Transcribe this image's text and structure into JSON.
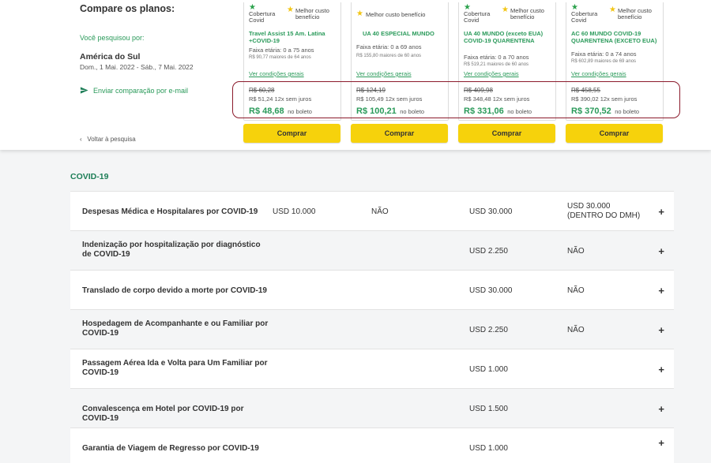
{
  "sidebar": {
    "title": "Compare os planos:",
    "searched_label": "Você pesquisou por:",
    "destination": "América do Sul",
    "dates": "Dom., 1 Mai. 2022 - Sáb., 7 Mai. 2022",
    "email_link": "Enviar comparação por e-mail",
    "back_link": "Voltar à pesquisa"
  },
  "plans": [
    {
      "badge_covid": "Cobertura Covid",
      "badge_best": "Melhor custo benefício",
      "name": "Travel Assist 15 Am. Latina +COVID-19",
      "age": "Faixa etária: 0 a 75 anos",
      "older": "R$ 90,77 maiores de 64 anos",
      "conditions": "Ver condições gerais",
      "old_price": "R$ 60,28",
      "installments": "R$ 51,24 12x sem juros",
      "price": "R$ 48,68",
      "boleto": "no boleto",
      "buy": "Comprar"
    },
    {
      "badge_covid": "",
      "badge_best": "Melhor custo benefício",
      "name": "UA 40 ESPECIAL MUNDO",
      "age": "Faixa etária: 0 a 69 anos",
      "older": "R$ 155,80 maiores de 60 anos",
      "conditions": "Ver condições gerais",
      "old_price": "R$ 124,19",
      "installments": "R$ 105,49 12x sem juros",
      "price": "R$ 100,21",
      "boleto": "no boleto",
      "buy": "Comprar"
    },
    {
      "badge_covid": "Cobertura Covid",
      "badge_best": "Melhor custo benefício",
      "name": "UA 40 MUNDO (exceto EUA) COVID-19 QUARENTENA",
      "age": "Faixa etária: 0 a 70 anos",
      "older": "R$ 519,21 maiores de 60 anos",
      "conditions": "Ver condições gerais",
      "old_price": "R$ 409,98",
      "installments": "R$ 348,48 12x sem juros",
      "price": "R$ 331,06",
      "boleto": "no boleto",
      "buy": "Comprar"
    },
    {
      "badge_covid": "Cobertura Covid",
      "badge_best": "Melhor custo benefício",
      "name": "AC 60 MUNDO COVID-19 QUARENTENA (EXCETO EUA)",
      "age": "Faixa etária: 0 a 74 anos",
      "older": "R$ 602,89 maiores de 69 anos",
      "conditions": "Ver condições gerais",
      "old_price": "R$ 458,55",
      "installments": "R$ 390,02 12x sem juros",
      "price": "R$ 370,52",
      "boleto": "no boleto",
      "buy": "Comprar"
    }
  ],
  "section": {
    "title": "COVID-19",
    "rows": [
      {
        "label": "Despesas Médica e Hospitalares por COVID-19",
        "values": [
          "USD 10.000",
          "NÃO",
          "USD 30.000",
          "USD 30.000 (DENTRO DO DMH)"
        ]
      },
      {
        "label": "Indenização por hospitalização por diagnóstico de COVID-19",
        "values": [
          "",
          "",
          "USD 2.250",
          "NÃO"
        ]
      },
      {
        "label": "Translado de corpo devido a morte por COVID-19",
        "values": [
          "",
          "",
          "USD 30.000",
          "NÃO"
        ]
      },
      {
        "label": "Hospedagem de Acompanhante e ou Familiar por COVID-19",
        "values": [
          "",
          "",
          "USD 2.250",
          "NÃO"
        ]
      },
      {
        "label": "Passagem Aérea Ida e Volta para Um Familiar por COVID-19",
        "values": [
          "",
          "",
          "USD 1.000",
          ""
        ]
      },
      {
        "label": "Convalescença em Hotel por COVID-19 por COVID-19",
        "values": [
          "",
          "",
          "USD 1.500",
          ""
        ]
      },
      {
        "label": "Garantia de Viagem de Regresso por COVID-19",
        "values": [
          "",
          "",
          "USD 1.000",
          ""
        ]
      }
    ]
  },
  "icons": {
    "plus": "+",
    "send": "send-icon",
    "back": "chevron-left-icon"
  },
  "colors": {
    "accent_green": "#2a9a5a",
    "buy_yellow": "#f6d20c",
    "highlight": "#8b1a2b"
  }
}
